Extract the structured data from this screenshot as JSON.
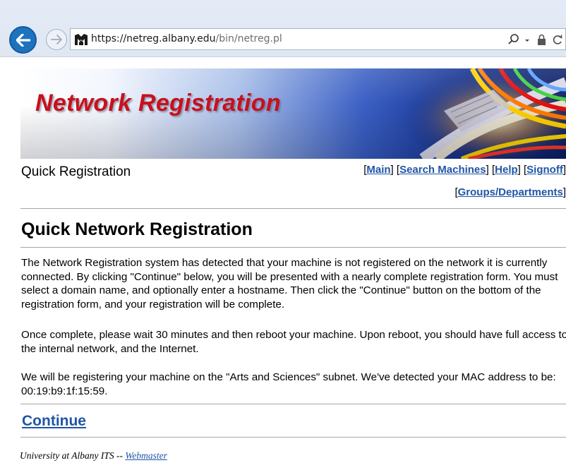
{
  "browser": {
    "url_host": "https://netreg.albany.edu",
    "url_path": "/bin/netreg.pl"
  },
  "banner": {
    "title": "Network Registration"
  },
  "header": {
    "section_label": "Quick Registration",
    "nav": {
      "main": "Main",
      "search_machines": "Search Machines",
      "help": "Help",
      "signoff": "Signoff",
      "groups_departments": "Groups/Departments"
    }
  },
  "main": {
    "heading": "Quick Network Registration",
    "paragraphs": [
      "The Network Registration system has detected that your machine is not registered on the network it is currently connected. By clicking \"Continue\" below, you will be presented with a nearly complete registration form. You must select a domain name, and optionally enter a hostname. Then click the \"Continue\" button on the bottom of the registration form, and your registration will be complete.",
      "Once complete, please wait 30 minutes and then reboot your machine. Upon reboot, you should have full access to the internal network, and the Internet.",
      "We will be registering your machine on the \"Arts and Sciences\" subnet. We've detected your MAC address to be: 00:19:b9:1f:15:59."
    ],
    "continue_label": "Continue"
  },
  "footer": {
    "org_text": "University at Albany ITS --",
    "webmaster_label": "Webmaster"
  },
  "icons": {
    "back": "back-arrow-icon",
    "forward": "forward-arrow-icon",
    "site": "site-favicon-icon",
    "search": "search-icon",
    "dropdown": "dropdown-icon",
    "lock": "lock-icon",
    "refresh": "refresh-icon"
  },
  "colors": {
    "link": "#1f55a6",
    "banner_title": "#c8101e",
    "back_button": "#1e73be"
  }
}
